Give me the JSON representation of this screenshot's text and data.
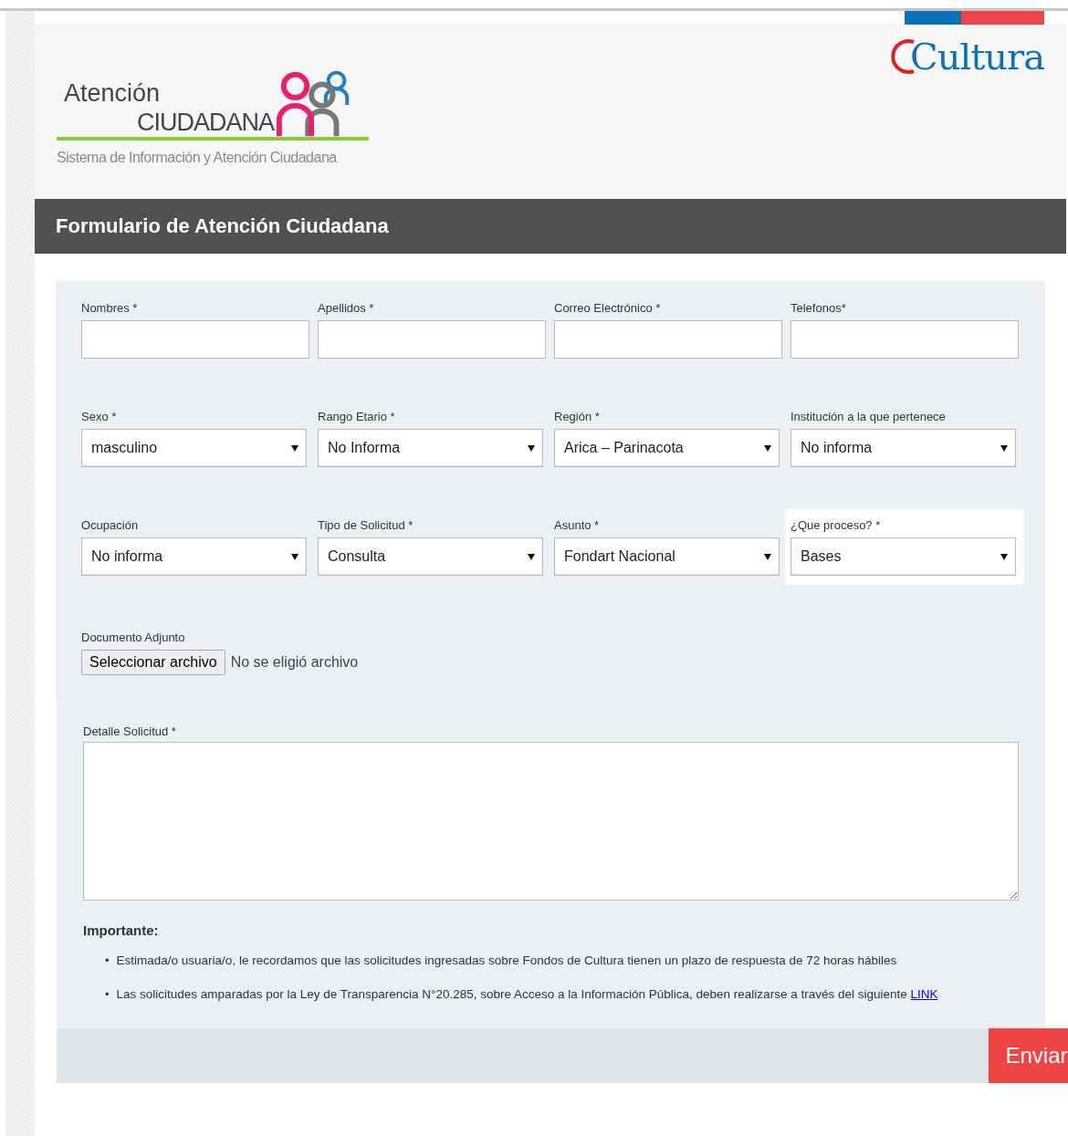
{
  "header": {
    "logo_line_1": "Atención",
    "logo_line_2": "CIUDADANA",
    "logo_subtitle": "Sistema de Información y Atención Ciudadana",
    "brand": "Cultura"
  },
  "form_title": "Formulario de Atención Ciudadana",
  "fields": [
    {
      "kind": "text",
      "label": "Nombres *"
    },
    {
      "kind": "text",
      "label": "Apellidos *"
    },
    {
      "kind": "text",
      "label": "Correo Electrónico *"
    },
    {
      "kind": "text",
      "label": "Telefonos*"
    },
    {
      "kind": "select",
      "label": "Sexo *",
      "value": "masculino"
    },
    {
      "kind": "select",
      "label": "Rango Etario *",
      "value": "No Informa"
    },
    {
      "kind": "select",
      "label": "Región *",
      "value": "Arica – Parinacota"
    },
    {
      "kind": "select",
      "label": "Institución a la que pertenece",
      "value": "No informa"
    },
    {
      "kind": "select",
      "label": "Ocupación",
      "value": "No informa"
    },
    {
      "kind": "select",
      "label": "Tipo de Solicitud *",
      "value": "Consulta"
    },
    {
      "kind": "select",
      "label": "Asunto *",
      "value": "Fondart Nacional"
    },
    {
      "kind": "select",
      "label": "¿Que proceso? *",
      "value": "Bases",
      "highlighted": true
    }
  ],
  "attachment": {
    "label": "Documento Adjunto",
    "button": "Seleccionar archivo",
    "status": "No se eligió archivo"
  },
  "detail": {
    "label": "Detalle Solicitud *"
  },
  "notice": {
    "title": "Importante:",
    "items": [
      {
        "bullet": "•",
        "text": "Estimada/o usuaria/o, le recordamos que las solicitudes ingresadas sobre Fondos de Cultura tienen un plazo de respuesta de 72 horas hábiles"
      },
      {
        "bullet": "•",
        "text": "Las solicitudes amparadas por la Ley de Transparencia N°20.285, sobre Acceso a la Información Pública, deben realizarse a través del siguiente",
        "link": "LINK"
      }
    ]
  },
  "submit": "Enviar"
}
